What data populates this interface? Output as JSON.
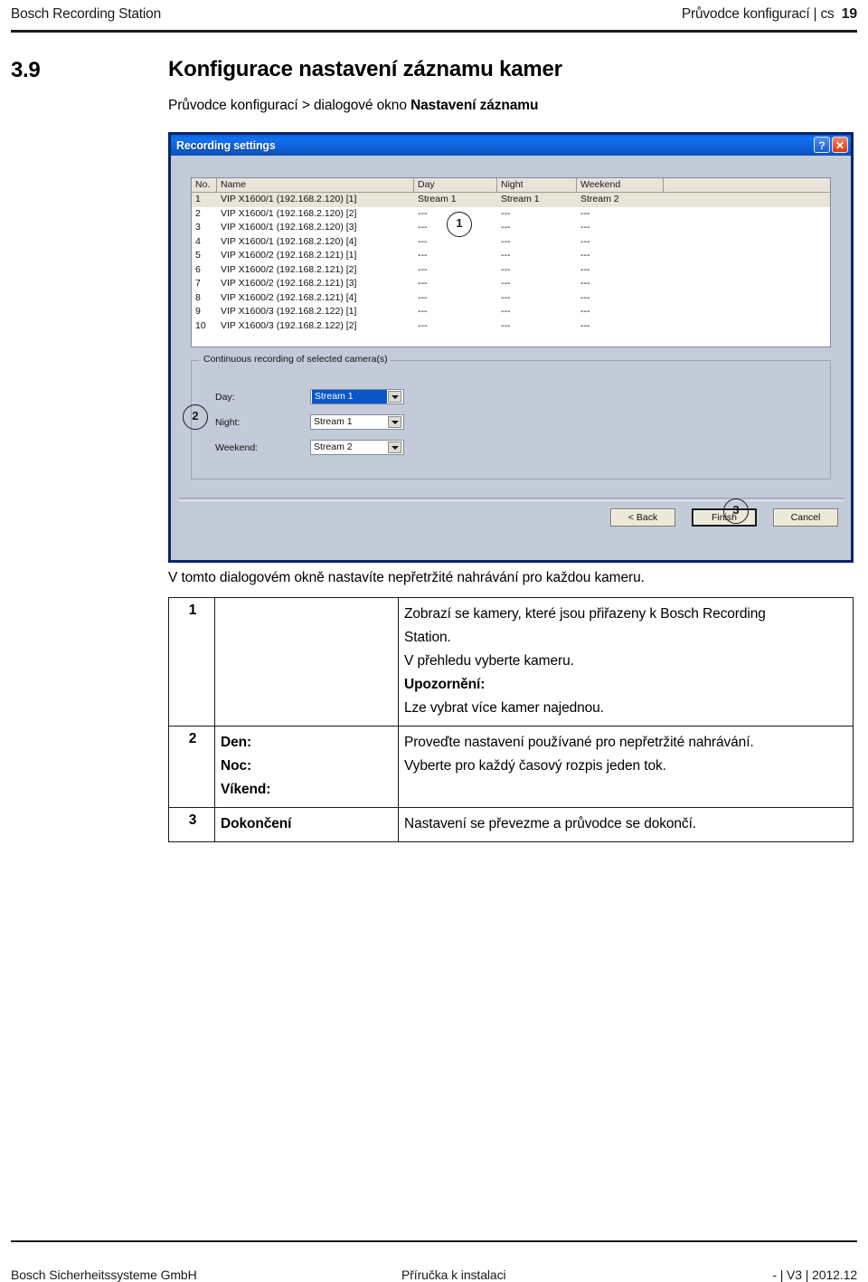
{
  "page_header": {
    "left": "Bosch Recording Station",
    "right": "Průvodce konfigurací | cs",
    "page_number": "19"
  },
  "section": {
    "number": "3.9",
    "title": "Konfigurace nastavení záznamu kamer",
    "breadcrumb_prefix": "Průvodce konfigurací > dialogové okno ",
    "breadcrumb_bold": "Nastavení záznamu"
  },
  "dialog": {
    "title": "Recording settings",
    "help_button": "?",
    "close_button": "✕",
    "listview": {
      "columns": [
        "No.",
        "Name",
        "Day",
        "Night",
        "Weekend",
        ""
      ],
      "rows": [
        {
          "no": "1",
          "name": "VIP X1600/1 (192.168.2.120) [1]",
          "day": "Stream 1",
          "night": "Stream 1",
          "weekend": "Stream 2",
          "selected": true
        },
        {
          "no": "2",
          "name": "VIP X1600/1 (192.168.2.120) [2]",
          "day": "---",
          "night": "---",
          "weekend": "---",
          "selected": false
        },
        {
          "no": "3",
          "name": "VIP X1600/1 (192.168.2.120) [3]",
          "day": "---",
          "night": "---",
          "weekend": "---",
          "selected": false
        },
        {
          "no": "4",
          "name": "VIP X1600/1 (192.168.2.120) [4]",
          "day": "---",
          "night": "---",
          "weekend": "---",
          "selected": false
        },
        {
          "no": "5",
          "name": "VIP X1600/2 (192.168.2.121) [1]",
          "day": "---",
          "night": "---",
          "weekend": "---",
          "selected": false
        },
        {
          "no": "6",
          "name": "VIP X1600/2 (192.168.2.121) [2]",
          "day": "---",
          "night": "---",
          "weekend": "---",
          "selected": false
        },
        {
          "no": "7",
          "name": "VIP X1600/2 (192.168.2.121) [3]",
          "day": "---",
          "night": "---",
          "weekend": "---",
          "selected": false
        },
        {
          "no": "8",
          "name": "VIP X1600/2 (192.168.2.121) [4]",
          "day": "---",
          "night": "---",
          "weekend": "---",
          "selected": false
        },
        {
          "no": "9",
          "name": "VIP X1600/3 (192.168.2.122) [1]",
          "day": "---",
          "night": "---",
          "weekend": "---",
          "selected": false
        },
        {
          "no": "10",
          "name": "VIP X1600/3 (192.168.2.122) [2]",
          "day": "---",
          "night": "---",
          "weekend": "---",
          "selected": false
        }
      ]
    },
    "groupbox": {
      "title": "Continuous recording of selected camera(s)",
      "fields": [
        {
          "label": "Day:",
          "value": "Stream 1",
          "focused": true
        },
        {
          "label": "Night:",
          "value": "Stream 1",
          "focused": false
        },
        {
          "label": "Weekend:",
          "value": "Stream 2",
          "focused": false
        }
      ]
    },
    "buttons": {
      "back": "< Back",
      "finish": "Finish",
      "cancel": "Cancel"
    },
    "callouts": [
      "1",
      "2",
      "3"
    ],
    "colors": {
      "titlebar": "#0f63dd",
      "face": "#c3cbd9",
      "border": "#0a246a",
      "selection": "#e8e4d7",
      "combo_focus": "#0a55c8"
    }
  },
  "intro": "V tomto dialogovém okně nastavíte nepřetržité nahrávání pro každou kameru.",
  "description_table": {
    "rows": [
      {
        "num": "1",
        "labels": [],
        "desc": [
          {
            "text": "Zobrazí se kamery, které jsou přiřazeny k Bosch Recording",
            "bold": false
          },
          {
            "text": "Station.",
            "bold": false
          },
          {
            "text": "V přehledu vyberte kameru.",
            "bold": false
          },
          {
            "text": "Upozornění:",
            "bold": true
          },
          {
            "text": "Lze vybrat více kamer najednou.",
            "bold": false
          }
        ]
      },
      {
        "num": "2",
        "labels": [
          {
            "text": "Den:",
            "bold": true
          },
          {
            "text": "Noc:",
            "bold": true
          },
          {
            "text": "Víkend:",
            "bold": true
          }
        ],
        "desc": [
          {
            "text": "Proveďte nastavení používané pro nepřetržité nahrávání.",
            "bold": false
          },
          {
            "text": "Vyberte pro každý časový rozpis jeden tok.",
            "bold": false
          }
        ]
      },
      {
        "num": "3",
        "labels": [
          {
            "text": "Dokončení",
            "bold": true
          }
        ],
        "desc": [
          {
            "text": "Nastavení se převezme a průvodce se dokončí.",
            "bold": false
          }
        ]
      }
    ]
  },
  "page_footer": {
    "left": "Bosch Sicherheitssysteme GmbH",
    "center": "Příručka k instalaci",
    "right": "- | V3 | 2012.12"
  }
}
